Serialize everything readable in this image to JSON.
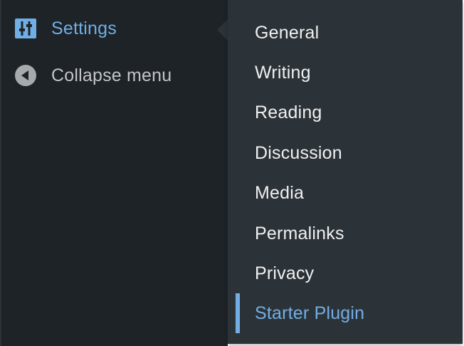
{
  "sidebar": {
    "items": [
      {
        "label": "Settings",
        "icon": "settings-sliders-icon",
        "active": true
      },
      {
        "label": "Collapse menu",
        "icon": "collapse-arrow-icon",
        "active": false
      }
    ]
  },
  "submenu": {
    "items": [
      {
        "label": "General"
      },
      {
        "label": "Writing"
      },
      {
        "label": "Reading"
      },
      {
        "label": "Discussion"
      },
      {
        "label": "Media"
      },
      {
        "label": "Permalinks"
      },
      {
        "label": "Privacy"
      },
      {
        "label": "Starter Plugin",
        "current": true
      }
    ]
  },
  "colors": {
    "sidebar_bg": "#1d2327",
    "submenu_bg": "#2c3338",
    "accent": "#72aee6",
    "text": "#f0f0f1",
    "muted_text": "#c3c4c7"
  }
}
